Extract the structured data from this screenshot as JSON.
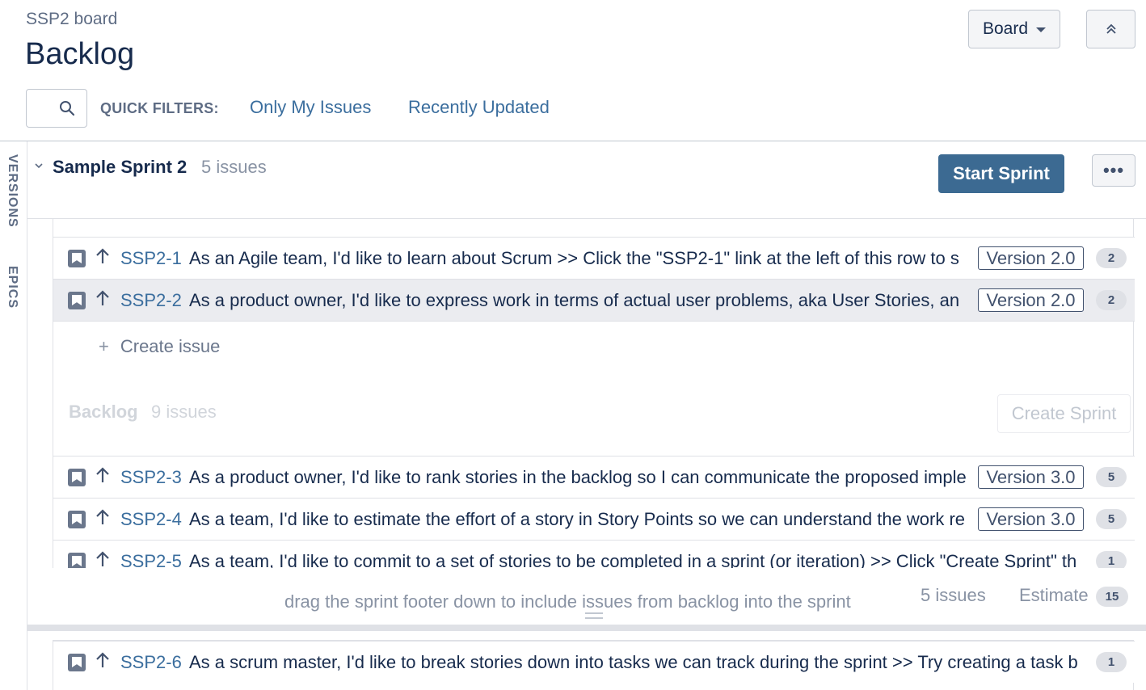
{
  "header": {
    "board_name": "SSP2 board",
    "title": "Backlog",
    "board_button_label": "Board"
  },
  "filters": {
    "label": "QUICK FILTERS:",
    "links": [
      "Only My Issues",
      "Recently Updated"
    ]
  },
  "side_tabs": [
    "VERSIONS",
    "EPICS"
  ],
  "sprint": {
    "name": "Sample Sprint 2",
    "count": "5 issues",
    "start_button": "Start Sprint",
    "more_label": "•••",
    "issues": [
      {
        "key": "SSP2-1",
        "summary": "As an Agile team, I'd like to learn about Scrum >> Click the \"SSP2-1\" link at the left of this row to s",
        "version": "Version 2.0",
        "points": "2"
      },
      {
        "key": "SSP2-2",
        "summary": "As a product owner, I'd like to express work in terms of actual user problems, aka User Stories, an",
        "version": "Version 2.0",
        "points": "2"
      }
    ],
    "create_issue": "Create issue",
    "footer": {
      "drag_hint": "drag the sprint footer down to include issues from backlog into the sprint",
      "count": "5 issues",
      "estimate_label": "Estimate",
      "estimate_value": "15"
    }
  },
  "backlog": {
    "title": "Backlog",
    "count": "9 issues",
    "create_sprint": "Create Sprint",
    "issues": [
      {
        "key": "SSP2-3",
        "summary": "As a product owner, I'd like to rank stories in the backlog so I can communicate the proposed imple",
        "version": "Version 3.0",
        "points": "5"
      },
      {
        "key": "SSP2-4",
        "summary": "As a team, I'd like to estimate the effort of a story in Story Points so we can understand the work re",
        "version": "Version 3.0",
        "points": "5"
      },
      {
        "key": "SSP2-5",
        "summary": "As a team, I'd like to commit to a set of stories to be completed in a sprint (or iteration) >> Click \"Create Sprint\" th",
        "version": "",
        "points": "1"
      },
      {
        "key": "SSP2-6",
        "summary": "As a scrum master, I'd like to break stories down into tasks we can track during the sprint >> Try creating a task b",
        "version": "",
        "points": "1"
      }
    ]
  },
  "colors": {
    "accent": "#3c6a92",
    "link": "#3b6e9e",
    "text": "#172b4d",
    "muted": "#8993a4"
  }
}
